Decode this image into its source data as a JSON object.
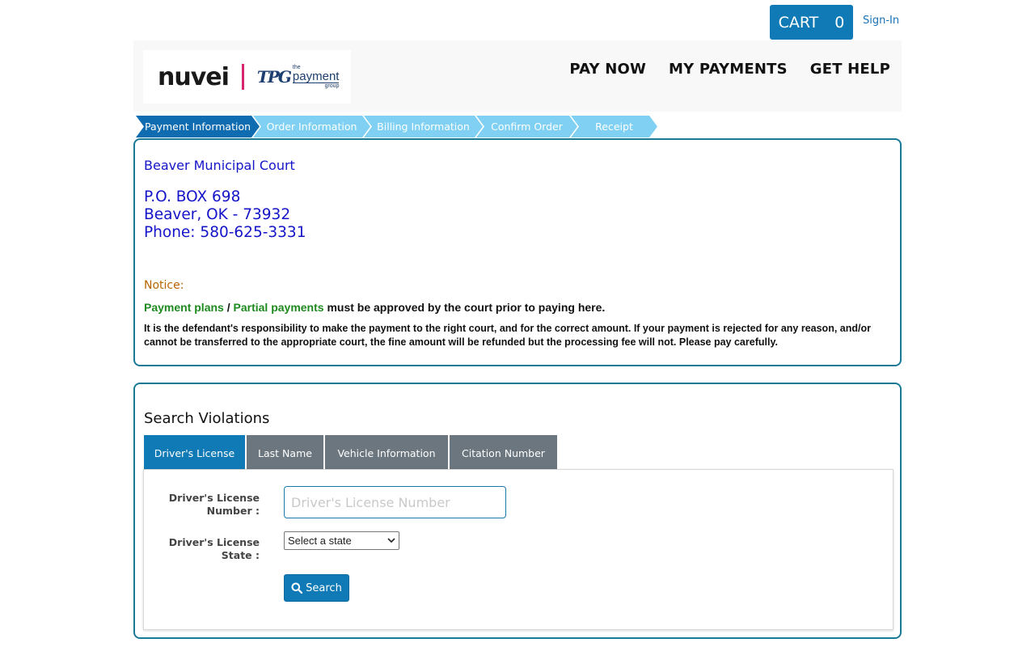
{
  "topbar": {
    "cart_label": "CART",
    "cart_count": "0",
    "signin_label": "Sign-In"
  },
  "header": {
    "logo_primary": "nuvei",
    "logo_tpg_mark": "TPG",
    "logo_tpg_the": "the",
    "logo_tpg_payment": "payment",
    "logo_tpg_group": "group",
    "nav": [
      "PAY NOW",
      "MY PAYMENTS",
      "GET HELP"
    ]
  },
  "steps": [
    {
      "label": "Payment Information",
      "state": "active"
    },
    {
      "label": "Order Information",
      "state": "todo"
    },
    {
      "label": "Billing Information",
      "state": "todo"
    },
    {
      "label": "Confirm Order",
      "state": "todo"
    },
    {
      "label": "Receipt",
      "state": "todo"
    }
  ],
  "court": {
    "name": "Beaver Municipal Court",
    "address_line1": "P.O. BOX 698",
    "address_line2": "Beaver, OK - 73932",
    "phone": "Phone: 580-625-3331",
    "notice_label": "Notice:",
    "notice_plans": "Payment plans",
    "notice_sep": " / ",
    "notice_partial": "Partial payments",
    "notice_rest": " must be approved by the court prior to paying here.",
    "notice_detail": "It is the defendant's responsibility to make the payment to the right court, and for the correct amount. If your payment is rejected for any reason, and/or cannot be transferred to the appropriate court, the fine amount will be refunded but the processing fee will not. Please pay carefully."
  },
  "search": {
    "title": "Search Violations",
    "tabs": [
      "Driver's License",
      "Last Name",
      "Vehicle Information",
      "Citation Number"
    ],
    "active_tab": "Driver's License",
    "dl_number_label_1": "Driver's License",
    "dl_number_label_2": "Number :",
    "dl_number_placeholder": "Driver's License Number",
    "dl_number_value": "",
    "dl_state_label_1": "Driver's License",
    "dl_state_label_2": "State :",
    "dl_state_selected": "Select a state",
    "search_button": "Search"
  },
  "colors": {
    "primary": "#0f7ab5",
    "step_active": "#0f6cb0",
    "step_todo": "#7fd0f2",
    "panel_border": "#1a7a96",
    "court_text": "#1414c8",
    "notice_label": "#b76500",
    "notice_green": "#1f8a1f",
    "tab_inactive": "#6b767e"
  },
  "icons": {
    "search_icon": "magnifier",
    "dropdown_icon": "chevron-down",
    "tpg_logo": "tpg-monogram"
  }
}
